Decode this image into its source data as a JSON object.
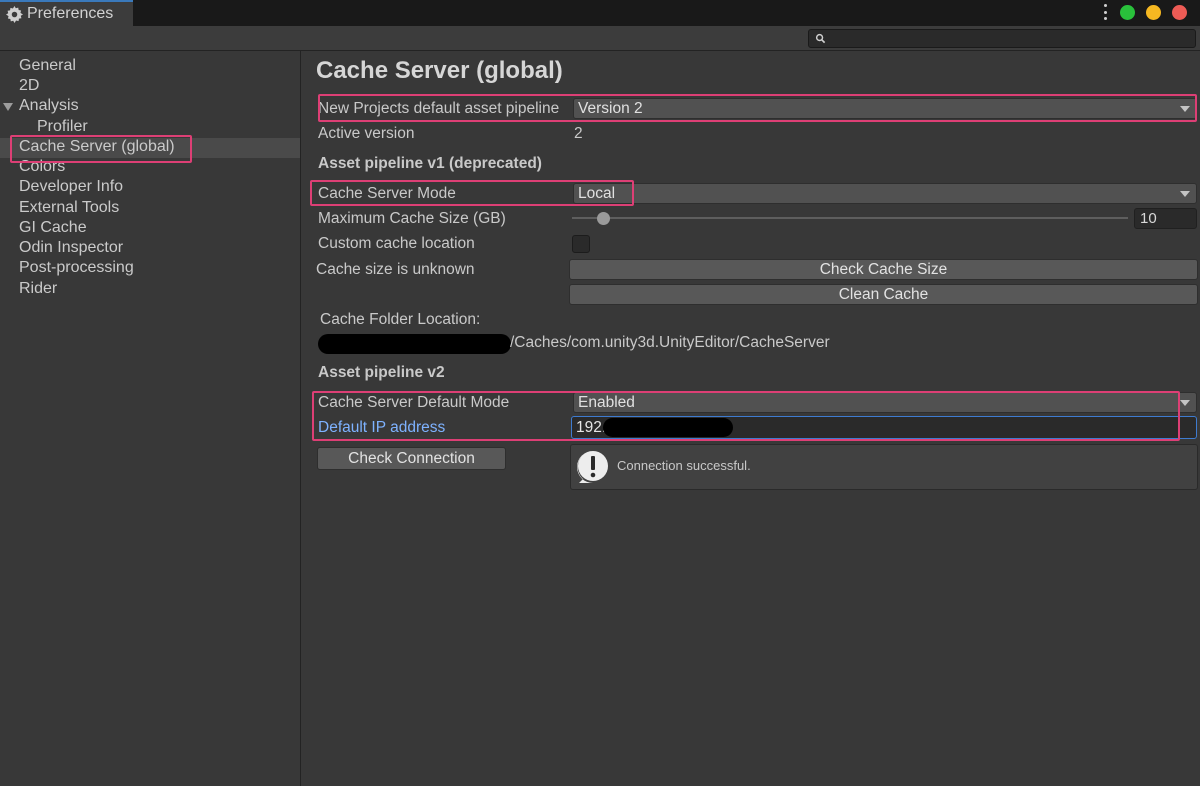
{
  "window": {
    "tab_title": "Preferences",
    "tab_icon": "gear-icon"
  },
  "colors": {
    "highlight": "#dd3f75",
    "link": "#7eb2ff",
    "accent_focus": "#3e7bd0"
  },
  "sidebar": {
    "items": [
      {
        "label": "General"
      },
      {
        "label": "2D"
      },
      {
        "label": "Analysis"
      },
      {
        "label": "Profiler"
      },
      {
        "label": "Cache Server (global)"
      },
      {
        "label": "Colors"
      },
      {
        "label": "Developer Info"
      },
      {
        "label": "External Tools"
      },
      {
        "label": "GI Cache"
      },
      {
        "label": "Odin Inspector"
      },
      {
        "label": "Post-processing"
      },
      {
        "label": "Rider"
      }
    ]
  },
  "main": {
    "title": "Cache Server (global)",
    "pipeline_label": "New Projects default asset pipeline",
    "pipeline_value": "Version 2",
    "active_version_label": "Active version",
    "active_version_value": "2",
    "v1_header": "Asset pipeline v1 (deprecated)",
    "mode_label": "Cache Server Mode",
    "mode_value": "Local",
    "max_size_label": "Maximum Cache Size (GB)",
    "max_size_value": "10",
    "max_size_fraction": 0.055,
    "custom_location_label": "Custom cache location",
    "cache_size_label": "Cache size is unknown",
    "check_size_button": "Check Cache Size",
    "clean_cache_button": "Clean Cache",
    "folder_location_label": "Cache Folder Location:",
    "folder_path": "/Caches/com.unity3d.UnityEditor/CacheServer",
    "v2_header": "Asset pipeline v2",
    "default_mode_label": "Cache Server Default Mode",
    "default_mode_value": "Enabled",
    "ip_label": "Default IP address",
    "ip_value": "192.",
    "check_connection_button": "Check Connection",
    "connection_message": "Connection successful."
  }
}
